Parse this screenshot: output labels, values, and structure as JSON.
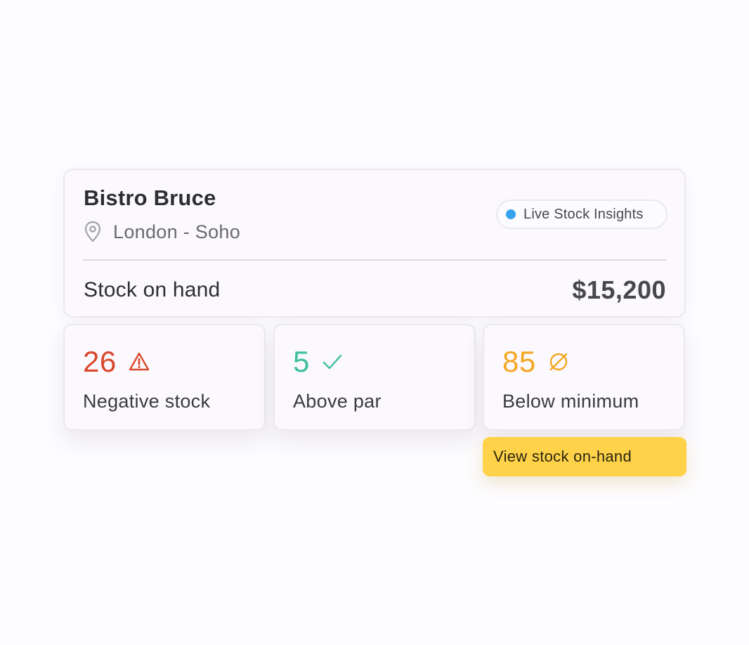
{
  "venue": {
    "name": "Bistro Bruce",
    "location": "London - Soho",
    "location_icon": "map-pin-icon"
  },
  "live_badge": {
    "label": "Live Stock Insights",
    "dot_color": "#35a3ec"
  },
  "stock_on_hand": {
    "label": "Stock on hand",
    "value": "$15,200"
  },
  "stats": [
    {
      "value": "26",
      "label": "Negative stock",
      "icon": "warning-triangle-icon",
      "color": "#d9482b"
    },
    {
      "value": "5",
      "label": "Above par",
      "icon": "checkmark-icon",
      "color": "#3fbf9e"
    },
    {
      "value": "85",
      "label": "Below minimum",
      "icon": "empty-set-icon",
      "color": "#f5a623"
    }
  ],
  "cta": {
    "label": "View stock on-hand",
    "color": "#ffd24a"
  }
}
